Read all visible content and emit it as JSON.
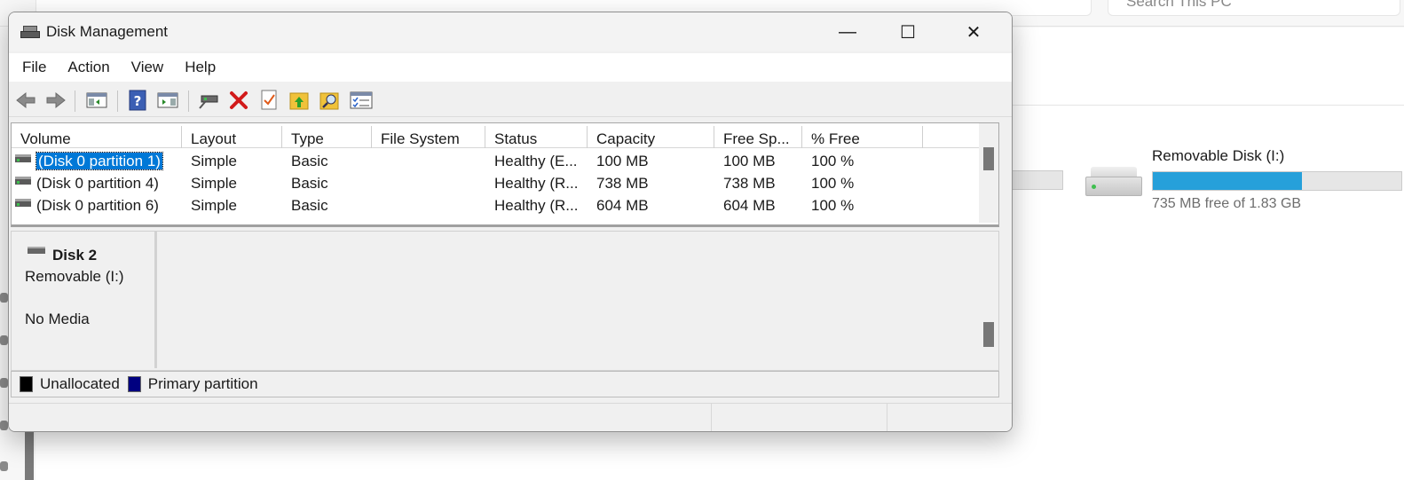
{
  "background": {
    "search_placeholder": "Search This PC",
    "drive": {
      "name": "Removable Disk (I:)",
      "free_text": "735 MB free of 1.83 GB",
      "used_fraction": 0.6,
      "bar_color": "#26a0da"
    }
  },
  "window": {
    "title": "Disk Management",
    "controls": {
      "minimize": "—",
      "maximize": "☐",
      "close": "✕"
    }
  },
  "menu": [
    "File",
    "Action",
    "View",
    "Help"
  ],
  "toolbar": [
    "back-icon",
    "forward-icon",
    "console-tree-icon",
    "help-icon",
    "action-pane-icon",
    "connect-disk-icon",
    "delete-icon",
    "properties-icon",
    "up-folder-icon",
    "search-icon",
    "settings-list-icon"
  ],
  "volumes": {
    "columns": [
      "Volume",
      "Layout",
      "Type",
      "File System",
      "Status",
      "Capacity",
      "Free Sp...",
      "% Free"
    ],
    "rows": [
      [
        "(Disk 0 partition 1)",
        "Simple",
        "Basic",
        "",
        "Healthy (E...",
        "100 MB",
        "100 MB",
        "100 %"
      ],
      [
        "(Disk 0 partition 4)",
        "Simple",
        "Basic",
        "",
        "Healthy (R...",
        "738 MB",
        "738 MB",
        "100 %"
      ],
      [
        "(Disk 0 partition 6)",
        "Simple",
        "Basic",
        "",
        "Healthy (R...",
        "604 MB",
        "604 MB",
        "100 %"
      ]
    ],
    "selected_row": 0
  },
  "disk": {
    "name": "Disk 2",
    "type": "Removable (I:)",
    "media": "No Media"
  },
  "legend": [
    {
      "label": "Unallocated",
      "color": "#000000"
    },
    {
      "label": "Primary partition",
      "color": "#000080"
    }
  ]
}
